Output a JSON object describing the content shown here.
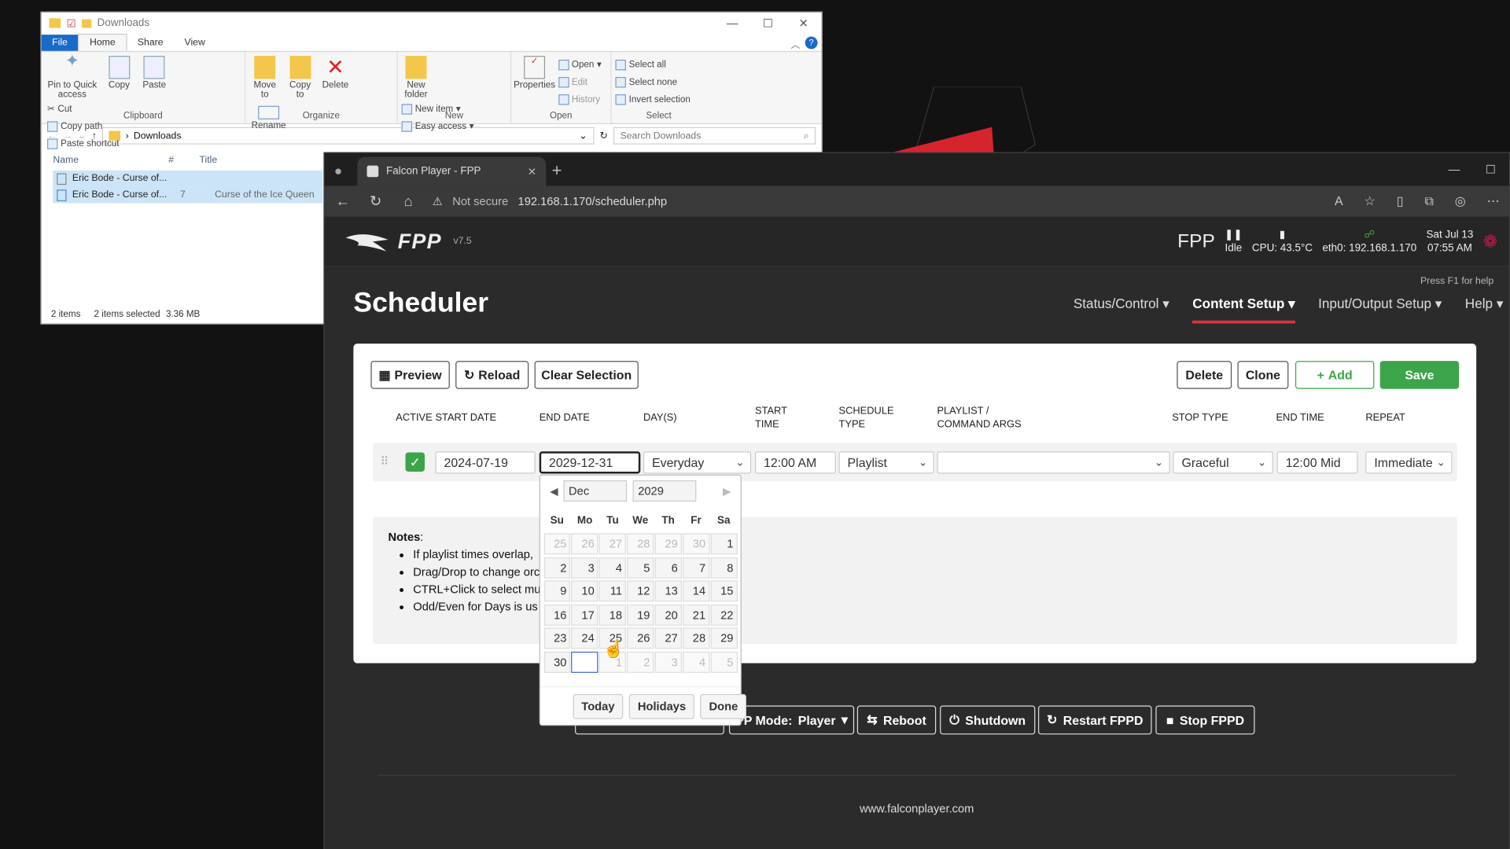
{
  "explorer": {
    "title": "Downloads",
    "ribbon_tabs": [
      "File",
      "Home",
      "Share",
      "View"
    ],
    "clipboard": {
      "pin": "Pin to Quick access",
      "copy": "Copy",
      "paste": "Paste",
      "cut": "Cut",
      "copy_path": "Copy path",
      "paste_shortcut": "Paste shortcut",
      "label": "Clipboard"
    },
    "organize": {
      "move": "Move to",
      "copy": "Copy to",
      "delete": "Delete",
      "rename": "Rename",
      "label": "Organize"
    },
    "new": {
      "folder": "New folder",
      "item": "New item",
      "easy": "Easy access",
      "label": "New"
    },
    "open": {
      "properties": "Properties",
      "open": "Open",
      "edit": "Edit",
      "history": "History",
      "label": "Open"
    },
    "select": {
      "all": "Select all",
      "none": "Select none",
      "invert": "Invert selection",
      "label": "Select"
    },
    "address": "Downloads",
    "search_placeholder": "Search Downloads",
    "columns": {
      "name": "Name",
      "num": "#",
      "title": "Title"
    },
    "files": [
      {
        "name": "Eric Bode - Curse of...",
        "num": "",
        "title": ""
      },
      {
        "name": "Eric Bode - Curse of...",
        "num": "7",
        "title": "Curse of the Ice Queen"
      }
    ],
    "status": {
      "items": "2 items",
      "selected": "2 items selected",
      "size": "3.36 MB"
    }
  },
  "browser": {
    "tab_title": "Falcon Player - FPP",
    "not_secure": "Not secure",
    "url": "192.168.1.170/scheduler.php"
  },
  "fpp": {
    "brand": "FPP",
    "version": "v7.5",
    "status_label": "FPP",
    "status": "Idle",
    "cpu": "CPU: 43.5°C",
    "eth": "eth0: 192.168.1.170",
    "date": "Sat Jul 13",
    "time": "07:55 AM",
    "help_hint": "Press F1 for help",
    "page_title": "Scheduler",
    "nav": [
      "Status/Control",
      "Content Setup",
      "Input/Output Setup",
      "Help"
    ],
    "buttons": {
      "preview": "Preview",
      "reload": "Reload",
      "clear": "Clear Selection",
      "delete": "Delete",
      "clone": "Clone",
      "add": "Add",
      "save": "Save"
    },
    "headers": {
      "active": "ACTIVE",
      "start_date": "START DATE",
      "end_date": "END DATE",
      "days": "DAY(S)",
      "start_time": "START TIME",
      "schedule_type": "SCHEDULE TYPE",
      "playlist": "PLAYLIST / COMMAND ARGS",
      "stop_type": "STOP TYPE",
      "end_time": "END TIME",
      "repeat": "REPEAT"
    },
    "row": {
      "start_date": "2024-07-19",
      "end_date": "2029-12-31",
      "days": "Everyday",
      "start_time": "12:00 AM",
      "schedule_type": "Playlist",
      "playlist": "",
      "stop_type": "Graceful",
      "end_time": "12:00 Mid",
      "repeat": "Immediate"
    },
    "notes_title": "Notes",
    "notes": [
      "If playlist times overlap,",
      "Drag/Drop to change orc",
      "CTRL+Click to select mu",
      "Odd/Even for Days is us"
    ],
    "bottom": {
      "mode_label": "PP Mode:",
      "mode": "Player",
      "reboot": "Reboot",
      "shutdown": "Shutdown",
      "restart": "Restart FPPD",
      "stop": "Stop FPPD"
    },
    "footer": "www.falconplayer.com"
  },
  "datepicker": {
    "month": "Dec",
    "year": "2029",
    "dow": [
      "Su",
      "Mo",
      "Tu",
      "We",
      "Th",
      "Fr",
      "Sa"
    ],
    "weeks": [
      [
        "25",
        "26",
        "27",
        "28",
        "29",
        "30",
        "1"
      ],
      [
        "2",
        "3",
        "4",
        "5",
        "6",
        "7",
        "8"
      ],
      [
        "9",
        "10",
        "11",
        "12",
        "13",
        "14",
        "15"
      ],
      [
        "16",
        "17",
        "18",
        "19",
        "20",
        "21",
        "22"
      ],
      [
        "23",
        "24",
        "25",
        "26",
        "27",
        "28",
        "29"
      ],
      [
        "30",
        "",
        "1",
        "2",
        "3",
        "4",
        "5"
      ]
    ],
    "buttons": {
      "today": "Today",
      "holidays": "Holidays",
      "done": "Done"
    }
  }
}
